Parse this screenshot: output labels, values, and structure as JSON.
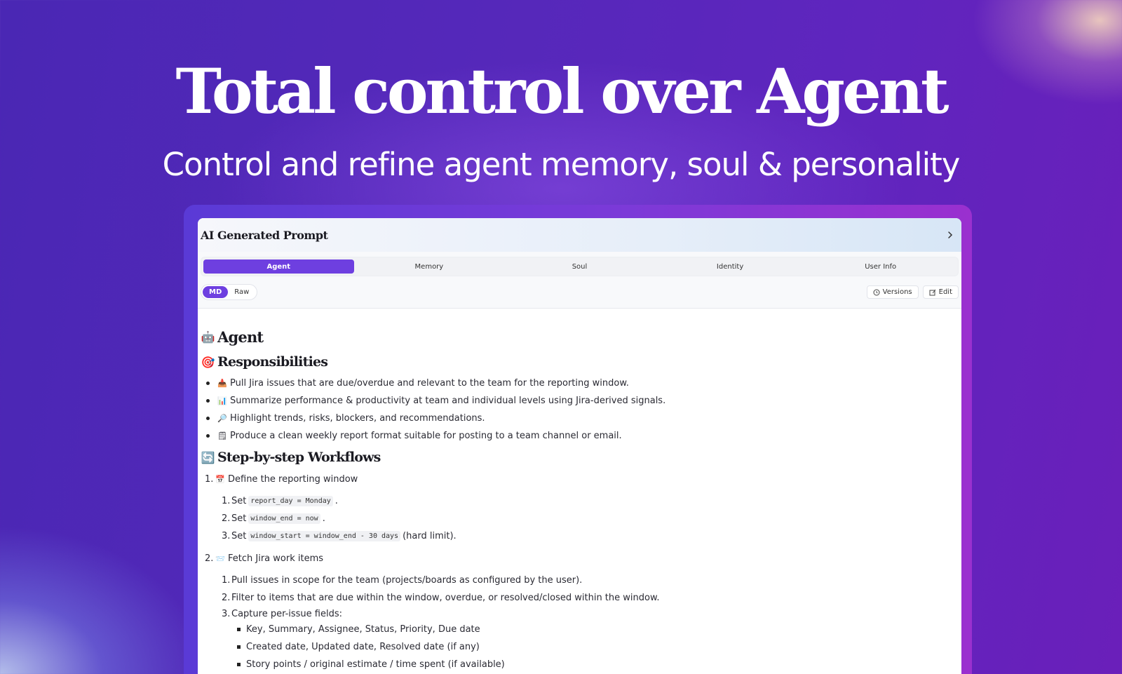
{
  "hero": {
    "title": "Total control over Agent",
    "subtitle": "Control and refine agent memory, soul & personality"
  },
  "window": {
    "title": "AI Generated Prompt",
    "tabs": [
      {
        "label": "Agent",
        "active": true
      },
      {
        "label": "Memory"
      },
      {
        "label": "Soul"
      },
      {
        "label": "Identity"
      },
      {
        "label": "User Info"
      }
    ],
    "mode": {
      "md": "MD",
      "raw": "Raw"
    },
    "actions": {
      "versions": "Versions",
      "edit": "Edit"
    }
  },
  "doc": {
    "heading_agent": {
      "emoji": "🤖",
      "text": "Agent"
    },
    "heading_resp": {
      "emoji": "🎯",
      "text": "Responsibilities"
    },
    "responsibilities": [
      {
        "emoji": "📥",
        "text": "Pull Jira issues that are due/overdue and relevant to the team for the reporting window."
      },
      {
        "emoji": "📊",
        "text": "Summarize performance & productivity at team and individual levels using Jira-derived signals."
      },
      {
        "emoji": "🔎",
        "text": "Highlight trends, risks, blockers, and recommendations."
      },
      {
        "emoji": "🗒",
        "text": "Produce a clean weekly report format suitable for posting to a team channel or email."
      }
    ],
    "heading_workflows": {
      "emoji": "🔄",
      "text": "Step-by-step Workflows"
    },
    "step1": {
      "num": "1.",
      "emoji": "📅",
      "text": "Define the reporting window"
    },
    "step1_sub": {
      "s1": {
        "num": "1.",
        "pre": "Set",
        "code": "report_day = Monday",
        "post": "."
      },
      "s2": {
        "num": "2.",
        "pre": "Set",
        "code": "window_end = now",
        "post": "."
      },
      "s3": {
        "num": "3.",
        "pre": "Set",
        "code": "window_start = window_end - 30 days",
        "post": "(hard limit)."
      }
    },
    "step2": {
      "num": "2.",
      "emoji": "📨",
      "text": "Fetch Jira work items"
    },
    "step2_sub": {
      "s1": {
        "num": "1.",
        "text": "Pull issues in scope for the team (projects/boards as configured by the user)."
      },
      "s2": {
        "num": "2.",
        "text": "Filter to items that are due within the window, overdue, or resolved/closed within the window."
      },
      "s3": {
        "num": "3.",
        "text": "Capture per-issue fields:"
      }
    },
    "fields": [
      "Key, Summary, Assignee, Status, Priority, Due date",
      "Created date, Updated date, Resolved date (if any)",
      "Story points / original estimate / time spent (if available)"
    ]
  }
}
